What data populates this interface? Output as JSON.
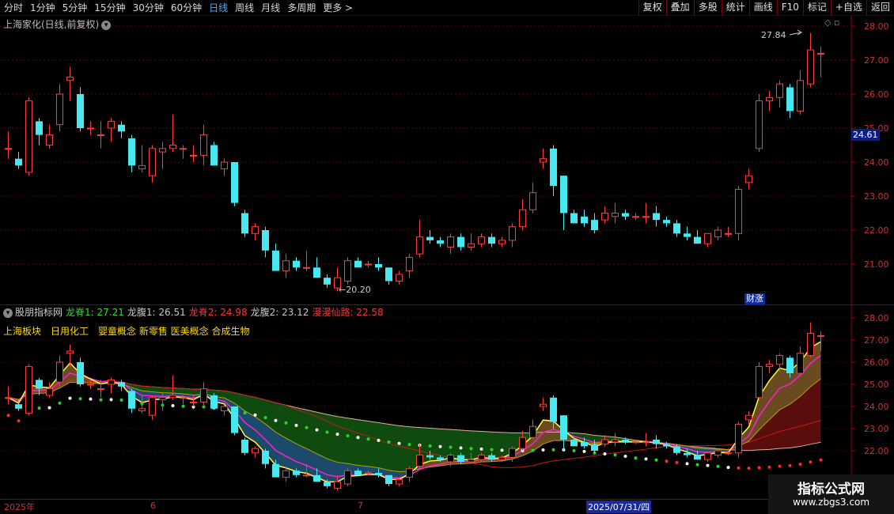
{
  "toolbar": {
    "periods": [
      "分时",
      "1分钟",
      "5分钟",
      "15分钟",
      "30分钟",
      "60分钟",
      "日线",
      "周线",
      "月线",
      "多周期",
      "更多 >"
    ],
    "active_period": "日线",
    "tools": [
      "复权",
      "叠加",
      "多股",
      "统计",
      "画线",
      "F10",
      "标记",
      "+自选",
      "返回"
    ]
  },
  "main_chart": {
    "title": "上海家化(日线,前复权)",
    "corner_icons": "◇ ▫",
    "price_axis": [
      "28.00",
      "27.00",
      "26.00",
      "25.00",
      "24.00",
      "23.00",
      "22.00",
      "21.00"
    ],
    "current_price": "24.61",
    "high_label": "27.84",
    "low_label": "20.20",
    "event_badge": "财涨"
  },
  "indicator": {
    "name": "股朋指标网",
    "fields": [
      {
        "label": "龙脊1: 27.21",
        "color": "#33dd33"
      },
      {
        "label": "龙腹1: 26.51",
        "color": "#c8c8c8"
      },
      {
        "label": "龙脊2: 24.98",
        "color": "#ff3333"
      },
      {
        "label": "龙腹2: 23.12",
        "color": "#c8c8c8"
      },
      {
        "label": "漫漫仙路: 22.58",
        "color": "#ff3333"
      }
    ],
    "concepts": [
      "上海板块",
      "日用化工",
      "婴童概念 新零售 医美概念 合成生物"
    ],
    "axis": [
      "28.00",
      "27.00",
      "26.00",
      "25.00",
      "24.00",
      "23.00",
      "22.00"
    ]
  },
  "date_axis": {
    "labels": [
      "2025年",
      "6",
      "7"
    ],
    "cursor": "2025/07/31/四"
  },
  "watermark": {
    "title": "指标公式网",
    "url": "www.zbgs3.com"
  },
  "chart_data": {
    "type": "candlestick",
    "title": "上海家化(日线,前复权)",
    "ylim": [
      20.0,
      28.2
    ],
    "colors": {
      "up": "#ff3c3c",
      "down": "#48e8f0"
    },
    "candles": [
      [
        24.4,
        24.9,
        24.1,
        24.4
      ],
      [
        24.1,
        24.3,
        23.8,
        23.9
      ],
      [
        23.7,
        25.9,
        23.6,
        25.8
      ],
      [
        25.2,
        25.3,
        24.5,
        24.8
      ],
      [
        24.5,
        25.1,
        24.4,
        24.8
      ],
      [
        25.1,
        26.3,
        24.9,
        26.0
      ],
      [
        26.4,
        26.8,
        25.8,
        26.5
      ],
      [
        26.0,
        26.2,
        24.9,
        25.0
      ],
      [
        25.0,
        25.2,
        24.8,
        25.0
      ],
      [
        24.8,
        25.2,
        24.4,
        24.8
      ],
      [
        25.0,
        25.3,
        24.6,
        25.2
      ],
      [
        25.1,
        25.2,
        24.7,
        24.9
      ],
      [
        24.7,
        24.8,
        23.7,
        23.9
      ],
      [
        23.8,
        24.5,
        23.7,
        23.9
      ],
      [
        23.6,
        24.5,
        23.4,
        24.4
      ],
      [
        24.3,
        24.6,
        23.8,
        24.4
      ],
      [
        24.4,
        25.4,
        24.3,
        24.5
      ],
      [
        24.4,
        24.5,
        24.1,
        24.4
      ],
      [
        24.2,
        24.5,
        24.0,
        24.2
      ],
      [
        24.2,
        25.1,
        23.9,
        24.8
      ],
      [
        24.5,
        24.6,
        23.9,
        23.9
      ],
      [
        23.8,
        24.1,
        23.6,
        24.0
      ],
      [
        24.0,
        24.0,
        22.7,
        22.8
      ],
      [
        22.5,
        22.6,
        21.8,
        21.9
      ],
      [
        21.9,
        22.2,
        21.7,
        22.1
      ],
      [
        22.0,
        22.1,
        21.2,
        21.4
      ],
      [
        21.4,
        21.6,
        20.8,
        20.8
      ],
      [
        20.8,
        21.3,
        20.6,
        21.1
      ],
      [
        21.1,
        21.2,
        20.8,
        20.9
      ],
      [
        20.9,
        21.4,
        20.8,
        20.9
      ],
      [
        20.9,
        21.2,
        20.6,
        20.6
      ],
      [
        20.6,
        20.7,
        20.3,
        20.4
      ],
      [
        20.3,
        20.9,
        20.2,
        20.6
      ],
      [
        20.5,
        21.2,
        20.4,
        21.1
      ],
      [
        21.1,
        21.2,
        20.9,
        20.9
      ],
      [
        21.0,
        21.1,
        20.9,
        21.0
      ],
      [
        21.0,
        21.2,
        20.8,
        20.9
      ],
      [
        20.9,
        20.9,
        20.4,
        20.5
      ],
      [
        20.5,
        20.8,
        20.4,
        20.7
      ],
      [
        20.8,
        21.3,
        20.6,
        21.2
      ],
      [
        21.3,
        22.3,
        21.2,
        21.8
      ],
      [
        21.8,
        22.0,
        21.6,
        21.7
      ],
      [
        21.7,
        21.8,
        21.5,
        21.6
      ],
      [
        21.5,
        21.9,
        21.3,
        21.8
      ],
      [
        21.8,
        21.9,
        21.4,
        21.5
      ],
      [
        21.5,
        21.9,
        21.4,
        21.6
      ],
      [
        21.6,
        21.9,
        21.5,
        21.8
      ],
      [
        21.8,
        21.9,
        21.5,
        21.6
      ],
      [
        21.6,
        21.8,
        21.5,
        21.7
      ],
      [
        21.7,
        22.2,
        21.5,
        22.1
      ],
      [
        22.1,
        22.9,
        22.0,
        22.6
      ],
      [
        22.6,
        23.4,
        22.5,
        23.1
      ],
      [
        24.0,
        24.4,
        23.8,
        24.1
      ],
      [
        24.4,
        24.5,
        23.0,
        23.3
      ],
      [
        23.6,
        23.6,
        22.0,
        22.5
      ],
      [
        22.5,
        22.6,
        22.2,
        22.2
      ],
      [
        22.4,
        22.6,
        22.1,
        22.2
      ],
      [
        22.3,
        22.5,
        21.9,
        22.0
      ],
      [
        22.3,
        22.7,
        22.2,
        22.5
      ],
      [
        22.4,
        22.8,
        22.2,
        22.5
      ],
      [
        22.5,
        22.6,
        22.3,
        22.4
      ],
      [
        22.4,
        22.5,
        22.3,
        22.4
      ],
      [
        22.4,
        22.8,
        22.2,
        22.4
      ],
      [
        22.5,
        22.7,
        22.1,
        22.3
      ],
      [
        22.3,
        22.4,
        22.1,
        22.2
      ],
      [
        22.2,
        22.3,
        21.8,
        21.9
      ],
      [
        21.9,
        22.1,
        21.7,
        21.8
      ],
      [
        21.8,
        22.0,
        21.6,
        21.6
      ],
      [
        21.6,
        21.9,
        21.5,
        21.9
      ],
      [
        21.8,
        22.1,
        21.7,
        22.0
      ],
      [
        21.9,
        22.1,
        21.8,
        21.9
      ],
      [
        21.9,
        23.3,
        21.7,
        23.2
      ],
      [
        23.4,
        23.8,
        23.2,
        23.6
      ],
      [
        24.4,
        26.0,
        24.3,
        25.8
      ],
      [
        25.8,
        26.1,
        25.5,
        25.9
      ],
      [
        25.9,
        26.4,
        25.6,
        26.3
      ],
      [
        26.2,
        26.3,
        25.3,
        25.5
      ],
      [
        25.5,
        26.7,
        25.4,
        26.4
      ],
      [
        26.3,
        27.8,
        26.2,
        27.3
      ],
      [
        27.2,
        27.4,
        26.5,
        27.2
      ]
    ]
  }
}
